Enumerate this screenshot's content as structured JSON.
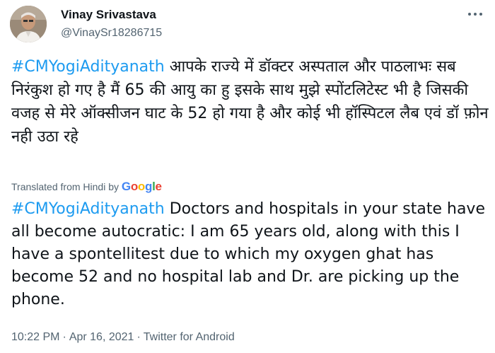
{
  "user": {
    "display_name": "Vinay Srivastava",
    "handle": "@VinaySr18286715"
  },
  "tweet": {
    "hashtag": "#CMYogiAdityanath",
    "hindi_text": " आपके राज्ये में डॉक्टर अस्पताल और पाठलाभः सब निरंकुश हो गए है मैं 65 की आयु का हु इसके साथ मुझे स्पोंटलिटेस्ट  भी है जिसकी वजह से मेरे ऑक्सीजन घाट के 52 हो गया है और कोई भी हॉस्पिटल लैब एवं डॉ फ़ोन नही उठा रहे",
    "translated_label": "Translated from Hindi by",
    "google": {
      "g1": "G",
      "g2": "o",
      "g3": "o",
      "g4": "g",
      "g5": "l",
      "g6": "e"
    },
    "english_text": " Doctors and hospitals in your state have all become autocratic: I am 65 years old, along with this I have a spontellitest due to which my oxygen ghat has become 52 and no hospital lab and Dr. are picking up the phone."
  },
  "meta": {
    "time": "10:22 PM",
    "date": "Apr 16, 2021",
    "source": "Twitter for Android",
    "separator": "·"
  },
  "colors": {
    "link": "#1d9bf0",
    "muted": "#536471",
    "text": "#0f1419"
  },
  "icons": {
    "more": "more-options-icon"
  }
}
